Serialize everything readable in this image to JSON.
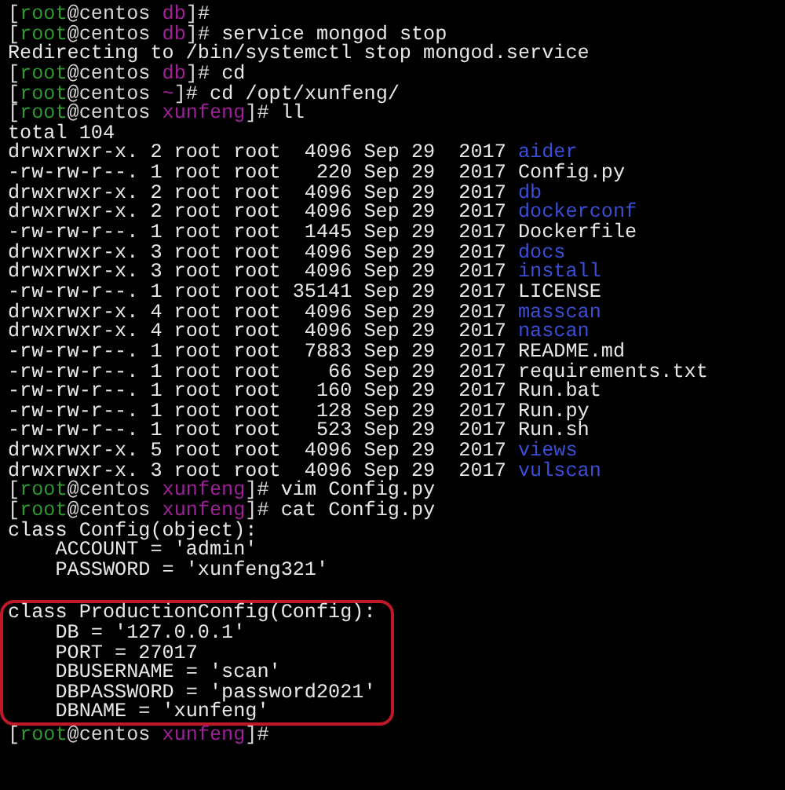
{
  "terminal": {
    "lines": [
      {
        "kind": "prompt",
        "open": "[",
        "user": "root",
        "host": "@centos",
        "cwd": "db",
        "close": "]#"
      },
      {
        "kind": "prompt",
        "open": "[",
        "user": "root",
        "host": "@centos",
        "cwd": "db",
        "close": "]#",
        "command": "service mongod stop"
      },
      {
        "kind": "output",
        "text": "Redirecting to /bin/systemctl stop mongod.service"
      },
      {
        "kind": "prompt",
        "open": "[",
        "user": "root",
        "host": "@centos",
        "cwd": "db",
        "close": "]#",
        "command": "cd"
      },
      {
        "kind": "prompt",
        "open": "[",
        "user": "root",
        "host": "@centos",
        "cwd": "~",
        "close": "]#",
        "command": "cd /opt/xunfeng/"
      },
      {
        "kind": "prompt",
        "open": "[",
        "user": "root",
        "host": "@centos",
        "cwd": "xunfeng",
        "close": "]#",
        "command": "ll"
      },
      {
        "kind": "output",
        "text": "total 104"
      },
      {
        "kind": "listing",
        "details": "drwxrwxr-x. 2 root root  4096 Sep 29  2017",
        "name": "aider",
        "is_dir": true
      },
      {
        "kind": "listing",
        "details": "-rw-rw-r--. 1 root root   220 Sep 29  2017",
        "name": "Config.py",
        "is_dir": false
      },
      {
        "kind": "listing",
        "details": "drwxrwxr-x. 2 root root  4096 Sep 29  2017",
        "name": "db",
        "is_dir": true
      },
      {
        "kind": "listing",
        "details": "drwxrwxr-x. 2 root root  4096 Sep 29  2017",
        "name": "dockerconf",
        "is_dir": true
      },
      {
        "kind": "listing",
        "details": "-rw-rw-r--. 1 root root  1445 Sep 29  2017",
        "name": "Dockerfile",
        "is_dir": false
      },
      {
        "kind": "listing",
        "details": "drwxrwxr-x. 3 root root  4096 Sep 29  2017",
        "name": "docs",
        "is_dir": true
      },
      {
        "kind": "listing",
        "details": "drwxrwxr-x. 3 root root  4096 Sep 29  2017",
        "name": "install",
        "is_dir": true
      },
      {
        "kind": "listing",
        "details": "-rw-rw-r--. 1 root root 35141 Sep 29  2017",
        "name": "LICENSE",
        "is_dir": false
      },
      {
        "kind": "listing",
        "details": "drwxrwxr-x. 4 root root  4096 Sep 29  2017",
        "name": "masscan",
        "is_dir": true
      },
      {
        "kind": "listing",
        "details": "drwxrwxr-x. 4 root root  4096 Sep 29  2017",
        "name": "nascan",
        "is_dir": true
      },
      {
        "kind": "listing",
        "details": "-rw-rw-r--. 1 root root  7883 Sep 29  2017",
        "name": "README.md",
        "is_dir": false
      },
      {
        "kind": "listing",
        "details": "-rw-rw-r--. 1 root root    66 Sep 29  2017",
        "name": "requirements.txt",
        "is_dir": false
      },
      {
        "kind": "listing",
        "details": "-rw-rw-r--. 1 root root   160 Sep 29  2017",
        "name": "Run.bat",
        "is_dir": false
      },
      {
        "kind": "listing",
        "details": "-rw-rw-r--. 1 root root   128 Sep 29  2017",
        "name": "Run.py",
        "is_dir": false
      },
      {
        "kind": "listing",
        "details": "-rw-rw-r--. 1 root root   523 Sep 29  2017",
        "name": "Run.sh",
        "is_dir": false
      },
      {
        "kind": "listing",
        "details": "drwxrwxr-x. 5 root root  4096 Sep 29  2017",
        "name": "views",
        "is_dir": true
      },
      {
        "kind": "listing",
        "details": "drwxrwxr-x. 3 root root  4096 Sep 29  2017",
        "name": "vulscan",
        "is_dir": true
      },
      {
        "kind": "prompt",
        "open": "[",
        "user": "root",
        "host": "@centos",
        "cwd": "xunfeng",
        "close": "]#",
        "command": "vim Config.py"
      },
      {
        "kind": "prompt",
        "open": "[",
        "user": "root",
        "host": "@centos",
        "cwd": "xunfeng",
        "close": "]#",
        "command": "cat Config.py"
      },
      {
        "kind": "output",
        "text": "class Config(object):"
      },
      {
        "kind": "output",
        "text": "    ACCOUNT = 'admin'"
      },
      {
        "kind": "output",
        "text": "    PASSWORD = 'xunfeng321'"
      },
      {
        "kind": "blank"
      },
      {
        "kind": "boxed",
        "lines": [
          {
            "kind": "output",
            "text": "class ProductionConfig(Config):"
          },
          {
            "kind": "output",
            "text": "    DB = '127.0.0.1'"
          },
          {
            "kind": "output",
            "text": "    PORT = 27017"
          },
          {
            "kind": "output",
            "text": "    DBUSERNAME = 'scan'"
          },
          {
            "kind": "output",
            "text": "    DBPASSWORD = 'password2021'"
          },
          {
            "kind": "output",
            "text": "    DBNAME = 'xunfeng'"
          }
        ]
      },
      {
        "kind": "prompt",
        "open": "[",
        "user": "root",
        "host": "@centos",
        "cwd": "xunfeng",
        "close": "]#"
      }
    ]
  }
}
